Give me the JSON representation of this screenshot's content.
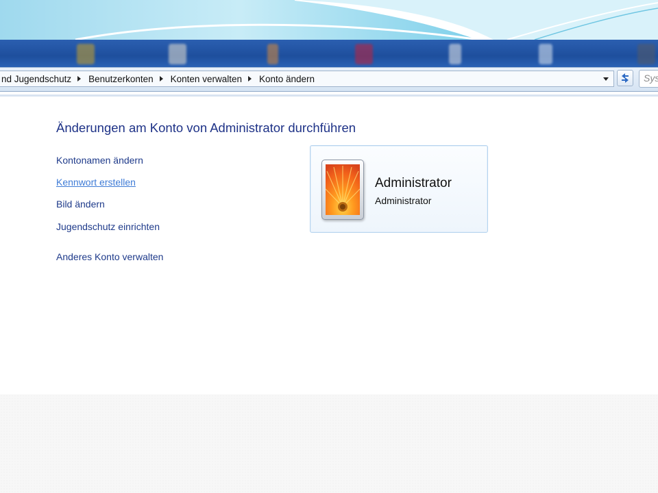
{
  "breadcrumb": {
    "items": [
      "nd Jugendschutz",
      "Benutzerkonten",
      "Konten verwalten",
      "Konto ändern"
    ]
  },
  "search": {
    "placeholder": "Sys"
  },
  "main": {
    "heading": "Änderungen am Konto von Administrator durchführen",
    "tasks": [
      "Kontonamen ändern",
      "Kennwort erstellen",
      "Bild ändern",
      "Jugendschutz einrichten",
      "Anderes Konto verwalten"
    ]
  },
  "account": {
    "name": "Administrator",
    "type": "Administrator"
  },
  "icons": {
    "refresh": "refresh-icon",
    "dropdown": "chevron-down-icon",
    "avatar": "flower-avatar-icon"
  },
  "colors": {
    "link": "#1e3a8a",
    "link_hover": "#3e7bd6",
    "heading": "#1e3287",
    "taskbar": "#1e4f9d"
  }
}
